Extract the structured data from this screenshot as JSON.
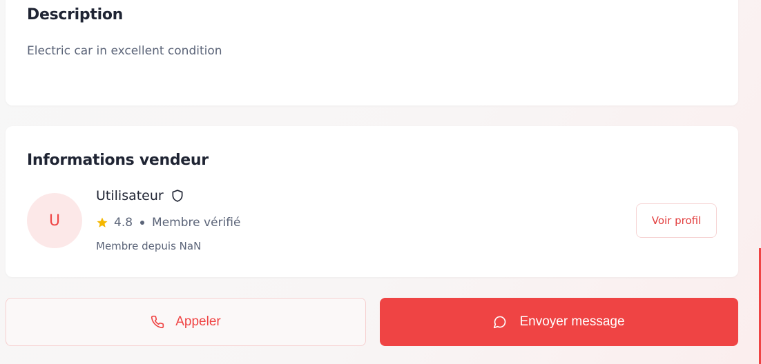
{
  "description": {
    "heading": "Description",
    "text": "Electric car in excellent condition"
  },
  "seller": {
    "heading": "Informations vendeur",
    "avatar_initial": "U",
    "name": "Utilisateur",
    "rating": "4.8",
    "verified_label": "Membre vérifié",
    "member_since": "Membre depuis NaN",
    "profile_button": "Voir profil"
  },
  "actions": {
    "call_label": "Appeler",
    "message_label": "Envoyer message"
  },
  "icons": {
    "verified": "shield-icon",
    "rating": "star-icon",
    "call": "phone-icon",
    "message": "chat-bubble-icon"
  },
  "colors": {
    "accent": "#ef4444",
    "star": "#f5b700",
    "avatar_bg": "#fce8e8"
  }
}
